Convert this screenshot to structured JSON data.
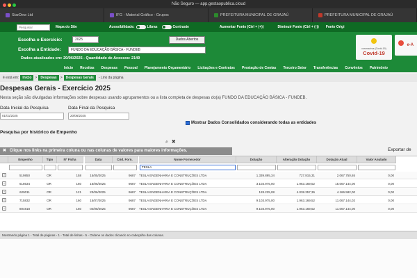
{
  "browser": {
    "title": "Não Seguro — app.gestaopublica.cloud",
    "tabs": [
      {
        "label": "StarDew Ltd",
        "color": "#7b4fc9"
      },
      {
        "label": "IFG - Material Gráfico - Grupos",
        "color": "#7b4fc9"
      },
      {
        "label": "PREFEITURA MUNICIPAL DE GRAJAÚ",
        "color": "#2c8a2c"
      },
      {
        "label": "PREFEITURA MUNICIPAL DE GRAJAÚ",
        "color": "#c0392b"
      }
    ]
  },
  "topbar": {
    "search_placeholder": "Pesquisar",
    "mapa": "Mapa do Site",
    "acessibilidade": "Acessibilidade:",
    "libras": "Libras",
    "contraste": "Contraste",
    "aumentar": "Aumentar Fonte (Ctrl + (+))",
    "diminuir": "Diminuir Fonte (Ctrl + (-))",
    "fonte": "Fonte Origi"
  },
  "header": {
    "exercicio_label": "Escolha o Exercício:",
    "exercicio_value": "2025",
    "entidade_label": "Escolha a Entidade:",
    "entidade_value": "FUNDO DA EDUCAÇÃO BÁSICA - FUNDEB",
    "dados_abertos": "Dados Abertos",
    "atualizados": "Dados atualizados em: 20/06/2025 - Quantidade de Acessos: 2149",
    "covid_small": "coronavírus (Covid-19)",
    "covid_big": "Covid-19",
    "covid2_text": "e-A"
  },
  "nav": [
    "Início",
    "Receitas",
    "Despesas",
    "Pessoal",
    "Planejamento Orçamentário",
    "Licitações e Contratos",
    "Prestação de Contas",
    "Terceiro Setor",
    "Transferências",
    "Convênios",
    "Patrimônio"
  ],
  "breadcrumb": {
    "prefix": "ê está em:",
    "items": [
      "Início",
      "Despesas",
      "Despesas Gerais"
    ],
    "suffix": "- Link da página"
  },
  "page": {
    "title": "Despesas Gerais - Exercício 2025",
    "description": "Nesta seção são divulgadas informações sobre despesas usando agrupamentos ou a lista completa de despesas do(a) FUNDO DA EDUCAÇÃO BÁSICA - FUNDEB.",
    "data_inicial_label": "Data Inicial da Pesquisa",
    "data_inicial": "01/01/2025",
    "data_final_label": "Data Final da Pesquisa",
    "data_final": "20/06/2025",
    "consolidados": "Mostrar Dados Consolidados considerando todas as entidades",
    "historico": "Pesquisa por histórico de Empenho",
    "notice": "Clique nos links na primeira coluna ou nas colunas de valores para maiores informações.",
    "exportar": "Exportar de"
  },
  "grid": {
    "columns": [
      "Empenho",
      "Tipo",
      "Nº Ficha",
      "Data",
      "Cód. Forn.",
      "Nome Fornecedor",
      "Dotação",
      "Alteração Dotação",
      "Dotação Atual",
      "Valor Anulado"
    ],
    "filter_fornecedor": "TESLA",
    "rows": [
      {
        "empenho": "519850",
        "tipo": "OR",
        "ficha": "158",
        "data": "15/05/2025",
        "cod": "9687",
        "nome": "TESLA ENGENHARIA E CONSTRUÇÕES LTDA",
        "dotacao": "1.339.895,34",
        "alteracao": "727.815,31",
        "atual": "2.067.750,65",
        "anulado": "0,00"
      },
      {
        "empenho": "618634",
        "tipo": "OR",
        "ficha": "160",
        "data": "16/06/2025",
        "cod": "9687",
        "nome": "TESLA ENGENHARIA E CONSTRUÇÕES LTDA",
        "dotacao": "3.103.975,00",
        "alteracao": "1.963.169,52",
        "atual": "15.067.144,00",
        "anulado": "0,00"
      },
      {
        "empenho": "629011",
        "tipo": "OR",
        "ficha": "121",
        "data": "23/06/2025",
        "cod": "9687",
        "nome": "TESLA ENGENHARIA E CONSTRUÇÕES LTDA",
        "dotacao": "128.225,08",
        "alteracao": "4.038.357,36",
        "atual": "4.166.582,00",
        "anulado": "0,00"
      },
      {
        "empenho": "715832",
        "tipo": "OR",
        "ficha": "160",
        "data": "15/07/2025",
        "cod": "9687",
        "nome": "TESLA ENGENHARIA E CONSTRUÇÕES LTDA",
        "dotacao": "9.103.975,00",
        "alteracao": "1.963.169,52",
        "atual": "11.067.144,02",
        "anulado": "0,00"
      },
      {
        "empenho": "804818",
        "tipo": "OR",
        "ficha": "160",
        "data": "04/08/2025",
        "cod": "9687",
        "nome": "TESLA ENGENHARIA E CONSTRUÇÕES LTDA",
        "dotacao": "9.103.975,00",
        "alteracao": "1.963.169,52",
        "atual": "11.067.144,00",
        "anulado": "0,00"
      }
    ],
    "footer": "Mostrando página 1 - Total de páginas - 1 - Total de linhas - 5 - Ordene os dados clicando no cabeçalho das colunas."
  }
}
